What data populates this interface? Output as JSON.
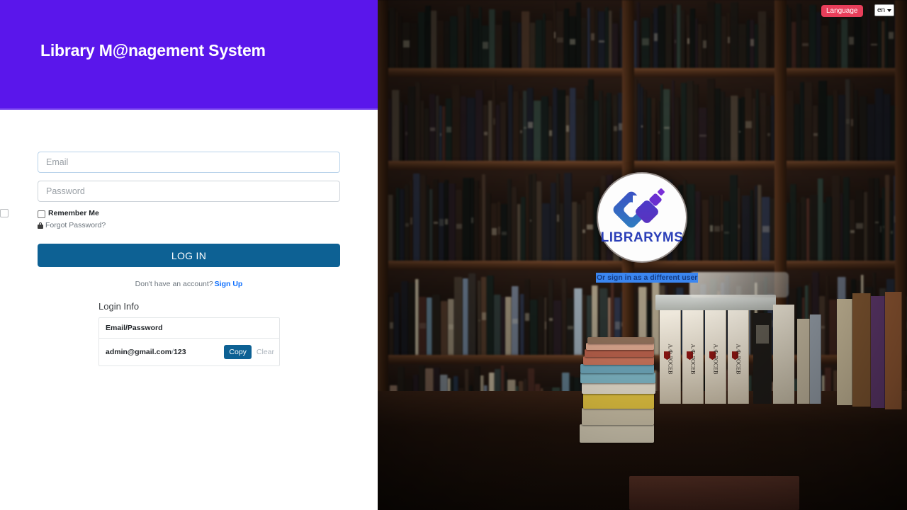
{
  "brand": {
    "title": "Library M@nagement System",
    "header_color": "#5a16eb"
  },
  "form": {
    "email_placeholder": "Email",
    "email_value": "",
    "password_placeholder": "Password",
    "password_value": "",
    "remember_label": "Remember Me",
    "forgot_label": "Forgot Password?",
    "lock_icon": "lock-icon",
    "login_button": "LOG IN",
    "login_button_color": "#0d6194",
    "signup_prompt": "Don't have an account?",
    "signup_link": "Sign Up",
    "signup_link_color": "#0d6efd"
  },
  "login_info": {
    "title": "Login Info",
    "columns": [
      "Email/Password"
    ],
    "rows": [
      {
        "email": "admin@gmail.com",
        "separator": "/",
        "password": "123",
        "copy_label": "Copy",
        "clear_label": "Clear"
      }
    ]
  },
  "overlay": {
    "language_badge": "Language",
    "language_selected": "en",
    "language_badge_color": "#e83e5a",
    "chevron_icon": "chevron-down-icon",
    "logo_text": "LIBRARYMS",
    "logo_icon": "libraryms-logo-icon",
    "different_user_link": "Or sign in as a different user",
    "selection_color": "#3b86f0"
  },
  "photo": {
    "description": "bookshelves",
    "foreground_spines": [
      "А.Ф.ЛОСЕВ",
      "А.Ф.ЛОСЕВ",
      "А.Ф.ЛОСЕВ",
      "А.Ф.ЛОСЕВ"
    ]
  }
}
